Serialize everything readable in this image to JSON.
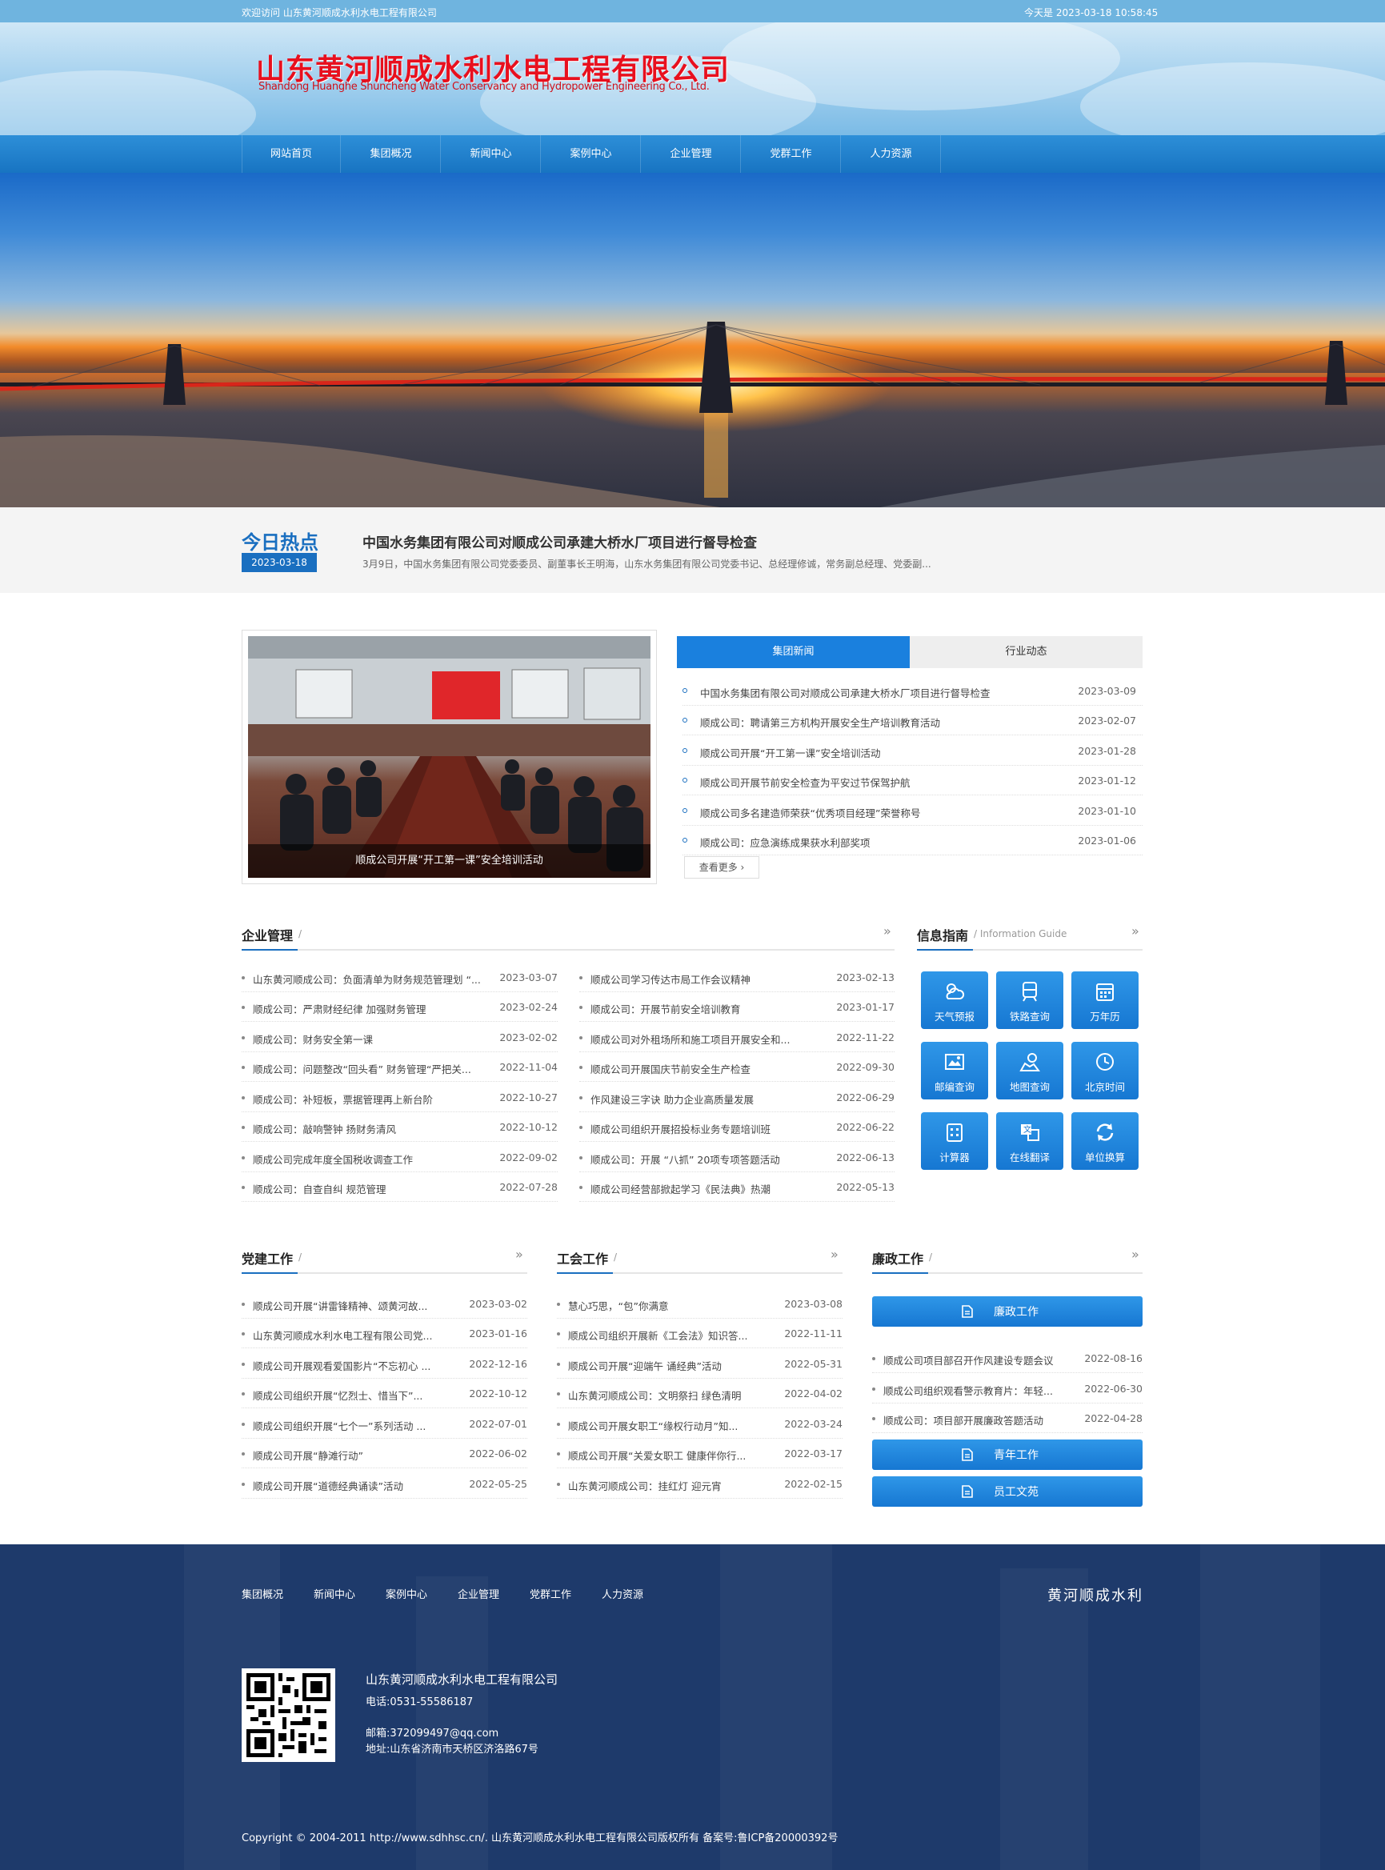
{
  "topbar": {
    "welcome": "欢迎访问 山东黄河顺成水利水电工程有限公司",
    "today": "今天是 2023-03-18 10:58:45"
  },
  "header": {
    "logo_cn": "山东黄河顺成水利水电工程有限公司",
    "logo_en": "Shandong Huanghe Shuncheng Water Conservancy and Hydropower Engineering Co., Ltd."
  },
  "nav": [
    "网站首页",
    "集团概况",
    "新闻中心",
    "案例中心",
    "企业管理",
    "党群工作",
    "人力资源"
  ],
  "hot": {
    "title": "今日热点",
    "date": "2023-03-18",
    "headline": "中国水务集团有限公司对顺成公司承建大桥水厂项目进行督导检查",
    "summary": "3月9日，中国水务集团有限公司党委委员、副董事长王明海，山东水务集团有限公司党委书记、总经理修诚，常务副总经理、党委副..."
  },
  "photo_caption": "顺成公司开展“开工第一课”安全培训活动",
  "news_tabs": [
    "集团新闻",
    "行业动态"
  ],
  "news": [
    {
      "title": "中国水务集团有限公司对顺成公司承建大桥水厂项目进行督导检查",
      "date": "2023-03-09"
    },
    {
      "title": "顺成公司：聘请第三方机构开展安全生产培训教育活动",
      "date": "2023-02-07"
    },
    {
      "title": "顺成公司开展“开工第一课”安全培训活动",
      "date": "2023-01-28"
    },
    {
      "title": "顺成公司开展节前安全检查为平安过节保驾护航",
      "date": "2023-01-12"
    },
    {
      "title": "顺成公司多名建造师荣获“优秀项目经理”荣誉称号",
      "date": "2023-01-10"
    },
    {
      "title": "顺成公司：应急演练成果获水利部奖项",
      "date": "2023-01-06"
    }
  ],
  "more_label": "查看更多 ›",
  "enterprise": {
    "title": "企业管理",
    "left": [
      {
        "title": "山东黄河顺成公司：负面清单为财务规范管理划 “...",
        "date": "2023-03-07"
      },
      {
        "title": "顺成公司：严肃财经纪律 加强财务管理",
        "date": "2023-02-24"
      },
      {
        "title": "顺成公司：财务安全第一课",
        "date": "2023-02-02"
      },
      {
        "title": "顺成公司：问题整改“回头看” 财务管理“严把关...",
        "date": "2022-11-04"
      },
      {
        "title": "顺成公司：补短板，票据管理再上新台阶",
        "date": "2022-10-27"
      },
      {
        "title": "顺成公司：敲响警钟 扬财务清风",
        "date": "2022-10-12"
      },
      {
        "title": "顺成公司完成年度全国税收调查工作",
        "date": "2022-09-02"
      },
      {
        "title": "顺成公司：自查自纠 规范管理",
        "date": "2022-07-28"
      }
    ],
    "right": [
      {
        "title": "顺成公司学习传达市局工作会议精神",
        "date": "2023-02-13"
      },
      {
        "title": "顺成公司：开展节前安全培训教育",
        "date": "2023-01-17"
      },
      {
        "title": "顺成公司对外租场所和施工项目开展安全和...",
        "date": "2022-11-22"
      },
      {
        "title": "顺成公司开展国庆节前安全生产检查",
        "date": "2022-09-30"
      },
      {
        "title": "作风建设三字诀 助力企业高质量发展",
        "date": "2022-06-29"
      },
      {
        "title": "顺成公司组织开展招投标业务专题培训班",
        "date": "2022-06-22"
      },
      {
        "title": "顺成公司：开展 “八抓” 20项专项答题活动",
        "date": "2022-06-13"
      },
      {
        "title": "顺成公司经营部掀起学习《民法典》热潮",
        "date": "2022-05-13"
      }
    ]
  },
  "info_guide": {
    "title": "信息指南",
    "subtitle": "/ Information Guide",
    "tiles": [
      "天气预报",
      "铁路查询",
      "万年历",
      "邮编查询",
      "地图查询",
      "北京时间",
      "计算器",
      "在线翻译",
      "单位换算"
    ]
  },
  "party": {
    "title": "党建工作",
    "items": [
      {
        "title": "顺成公司开展“讲雷锋精神、颂黄河故...",
        "date": "2023-03-02"
      },
      {
        "title": "山东黄河顺成水利水电工程有限公司党...",
        "date": "2023-01-16"
      },
      {
        "title": "顺成公司开展观看爱国影片“不忘初心 ...",
        "date": "2022-12-16"
      },
      {
        "title": "顺成公司组织开展“忆烈士、惜当下”...",
        "date": "2022-10-12"
      },
      {
        "title": "顺成公司组织开展“七个一”系列活动 ...",
        "date": "2022-07-01"
      },
      {
        "title": "顺成公司开展“静滩行动”",
        "date": "2022-06-02"
      },
      {
        "title": "顺成公司开展“道德经典诵读”活动",
        "date": "2022-05-25"
      }
    ]
  },
  "union": {
    "title": "工会工作",
    "items": [
      {
        "title": "慧心巧思，“包”你满意",
        "date": "2023-03-08"
      },
      {
        "title": "顺成公司组织开展新《工会法》知识答...",
        "date": "2022-11-11"
      },
      {
        "title": "顺成公司开展“迎端午 诵经典”活动",
        "date": "2022-05-31"
      },
      {
        "title": "山东黄河顺成公司：文明祭扫 绿色清明",
        "date": "2022-04-02"
      },
      {
        "title": "顺成公司开展女职工“缘权行动月”知...",
        "date": "2022-03-24"
      },
      {
        "title": "顺成公司开展“关爱女职工 健康伴你行...",
        "date": "2022-03-17"
      },
      {
        "title": "山东黄河顺成公司：挂红灯 迎元宵",
        "date": "2022-02-15"
      }
    ]
  },
  "integrity": {
    "title": "廉政工作",
    "button1": "廉政工作",
    "items": [
      {
        "title": "顺成公司项目部召开作风建设专题会议",
        "date": "2022-08-16"
      },
      {
        "title": "顺成公司组织观看警示教育片：年轻...",
        "date": "2022-06-30"
      },
      {
        "title": "顺成公司：项目部开展廉政答题活动",
        "date": "2022-04-28"
      }
    ],
    "button2": "青年工作",
    "button3": "员工文苑"
  },
  "footer": {
    "nav": [
      "集团概况",
      "新闻中心",
      "案例中心",
      "企业管理",
      "党群工作",
      "人力资源"
    ],
    "brand": "黄河顺成水利",
    "company": "山东黄河顺成水利水电工程有限公司",
    "phone": "电话:0531-55586187",
    "email": "邮箱:372099497@qq.com",
    "address": "地址:山东省济南市天桥区济洛路67号",
    "copyright": "Copyright © 2004-2011 http://www.sdhhsc.cn/. 山东黄河顺成水利水电工程有限公司版权所有 备案号:鲁ICP备20000392号"
  },
  "colors": {
    "primary": "#1a6fc0",
    "accent_red": "#e8101e",
    "footer_bg": "#1e3a6b"
  }
}
